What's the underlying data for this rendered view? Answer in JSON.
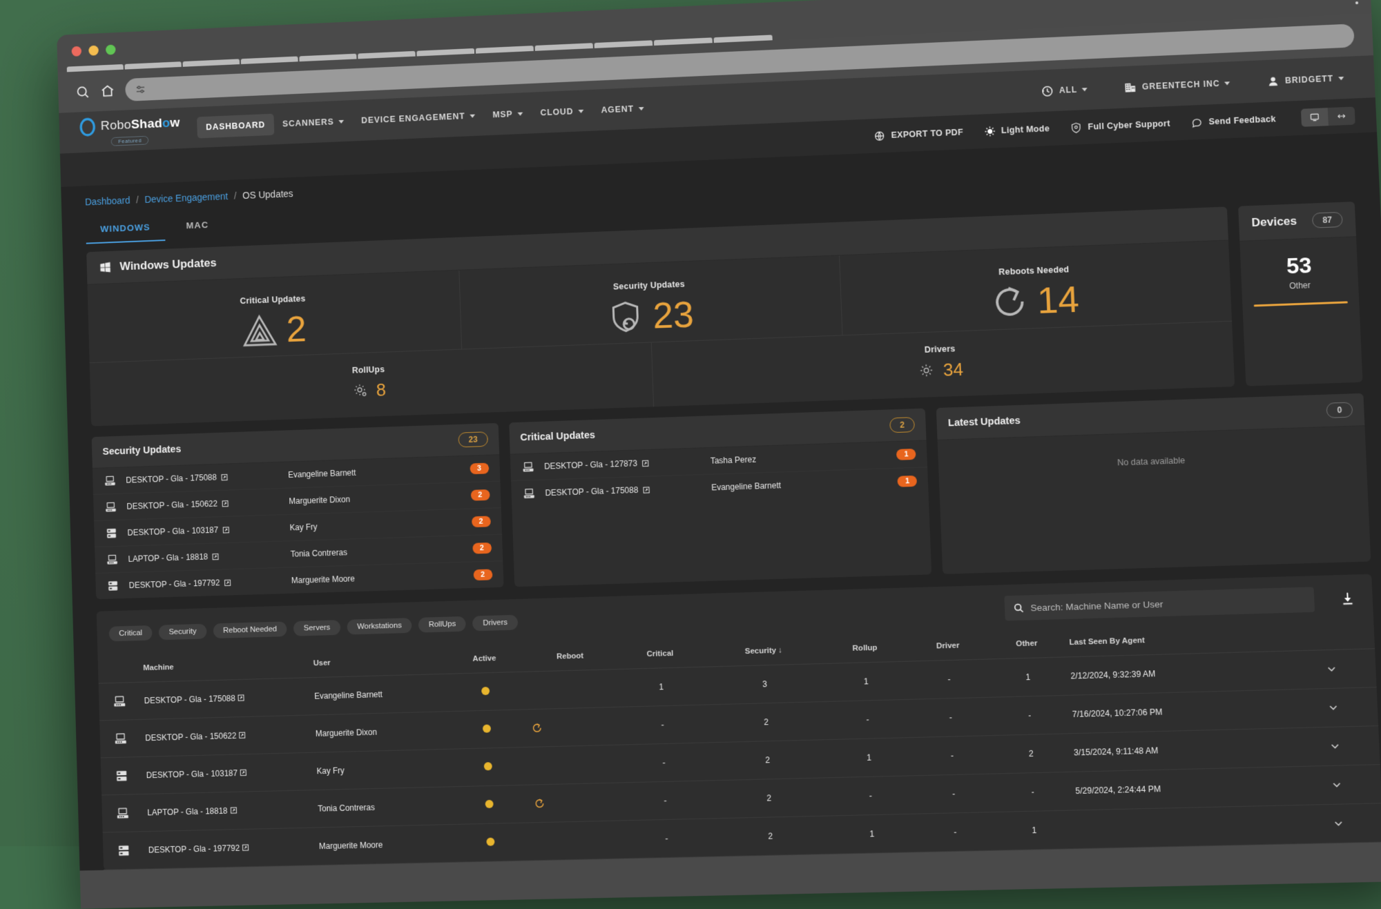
{
  "browser": {
    "search_icon": "search-icon",
    "home_icon": "home-icon",
    "omnibox_icon": "tune-icon",
    "menu_icon": "kebab-menu-icon"
  },
  "nav": {
    "brand_pre": "Robo",
    "brand_bold": "Shad",
    "brand_o": "o",
    "brand_post": "w",
    "brand_badge": "Featured",
    "items": [
      {
        "label": "DASHBOARD",
        "caret": false,
        "active": true
      },
      {
        "label": "SCANNERS",
        "caret": true,
        "active": false
      },
      {
        "label": "DEVICE ENGAGEMENT",
        "caret": true,
        "active": false
      },
      {
        "label": "MSP",
        "caret": true,
        "active": false
      },
      {
        "label": "CLOUD",
        "caret": true,
        "active": false
      },
      {
        "label": "AGENT",
        "caret": true,
        "active": false
      }
    ],
    "right": [
      {
        "label": "ALL",
        "icon": "history-icon",
        "caret": true
      },
      {
        "label": "GREENTECH INC",
        "icon": "building-icon",
        "caret": true
      },
      {
        "label": "BRIDGETT",
        "icon": "person-icon",
        "caret": true
      }
    ]
  },
  "subbar": {
    "export_label": "EXPORT TO PDF",
    "light_mode_label": "Light Mode",
    "support_label": "Full Cyber Support",
    "feedback_label": "Send Feedback",
    "seg_left_icon": "monitor-icon",
    "seg_right_icon": "expand-horizontal-icon"
  },
  "breadcrumb": {
    "item1": "Dashboard",
    "sep": "/",
    "item2": "Device Engagement",
    "current": "OS Updates"
  },
  "tabs": [
    {
      "label": "WINDOWS",
      "selected": true
    },
    {
      "label": "MAC",
      "selected": false
    }
  ],
  "windows_updates": {
    "title": "Windows Updates",
    "icon": "windows-icon",
    "stats_top": [
      {
        "label": "Critical Updates",
        "value": "2",
        "icon": "warning-triangle-icon"
      },
      {
        "label": "Security Updates",
        "value": "23",
        "icon": "shield-refresh-icon"
      },
      {
        "label": "Reboots Needed",
        "value": "14",
        "icon": "reboot-icon"
      }
    ],
    "stats_bottom": [
      {
        "label": "RollUps",
        "value": "8",
        "icon": "gear-icon"
      },
      {
        "label": "Drivers",
        "value": "34",
        "icon": "gear-icon"
      }
    ]
  },
  "devices": {
    "title": "Devices",
    "count": "87",
    "value": "53",
    "label": "Other",
    "bar_color": "#e8a33d"
  },
  "panels": [
    {
      "title": "Security Updates",
      "count": "23",
      "rows": [
        {
          "icon": "desktop-icon",
          "machine": "DESKTOP - Gla - 175088",
          "link_icon": "external-link-icon",
          "user": "Evangeline Barnett",
          "badge": "3"
        },
        {
          "icon": "desktop-icon",
          "machine": "DESKTOP - Gla - 150622",
          "link_icon": "external-link-icon",
          "user": "Marguerite Dixon",
          "badge": "2"
        },
        {
          "icon": "server-icon",
          "machine": "DESKTOP - Gla - 103187",
          "link_icon": "external-link-icon",
          "user": "Kay Fry",
          "badge": "2"
        },
        {
          "icon": "desktop-icon",
          "machine": "LAPTOP - Gla - 18818",
          "link_icon": "external-link-icon",
          "user": "Tonia Contreras",
          "badge": "2"
        },
        {
          "icon": "server-icon",
          "machine": "DESKTOP - Gla - 197792",
          "link_icon": "external-link-icon",
          "user": "Marguerite Moore",
          "badge": "2"
        }
      ],
      "empty": ""
    },
    {
      "title": "Critical Updates",
      "count": "2",
      "rows": [
        {
          "icon": "desktop-icon",
          "machine": "DESKTOP - Gla - 127873",
          "link_icon": "external-link-icon",
          "user": "Tasha Perez",
          "badge": "1"
        },
        {
          "icon": "desktop-icon",
          "machine": "DESKTOP - Gla - 175088",
          "link_icon": "external-link-icon",
          "user": "Evangeline Barnett",
          "badge": "1"
        }
      ],
      "empty": ""
    },
    {
      "title": "Latest Updates",
      "count": "0",
      "rows": [],
      "empty": "No data available"
    }
  ],
  "filters": {
    "chips": [
      "Critical",
      "Security",
      "Reboot Needed",
      "Servers",
      "Workstations",
      "RollUps",
      "Drivers"
    ],
    "search_placeholder": "Search: Machine Name or User",
    "search_value": "",
    "search_icon": "search-icon",
    "download_icon": "download-icon"
  },
  "table": {
    "columns": [
      "",
      "Machine",
      "User",
      "Active",
      "Reboot",
      "Critical",
      "Security ↓",
      "Rollup",
      "Driver",
      "Other",
      "Last Seen By Agent",
      ""
    ],
    "rows": [
      {
        "icon": "desktop-icon",
        "machine": "DESKTOP - Gla - 175088",
        "link_icon": "external-link-icon",
        "user": "Evangeline Barnett",
        "active": "active-dot",
        "reboot": "",
        "critical": "1",
        "security": "3",
        "rollup": "1",
        "driver": "-",
        "other": "1",
        "last_seen": "2/12/2024, 9:32:39 AM",
        "expand_icon": "chevron-down-icon"
      },
      {
        "icon": "desktop-icon",
        "machine": "DESKTOP - Gla - 150622",
        "link_icon": "external-link-icon",
        "user": "Marguerite Dixon",
        "active": "active-dot",
        "reboot": "reboot-icon",
        "critical": "-",
        "security": "2",
        "rollup": "-",
        "driver": "-",
        "other": "-",
        "last_seen": "7/16/2024, 10:27:06 PM",
        "expand_icon": "chevron-down-icon"
      },
      {
        "icon": "server-icon",
        "machine": "DESKTOP - Gla - 103187",
        "link_icon": "external-link-icon",
        "user": "Kay Fry",
        "active": "active-dot",
        "reboot": "",
        "critical": "-",
        "security": "2",
        "rollup": "1",
        "driver": "-",
        "other": "2",
        "last_seen": "3/15/2024, 9:11:48 AM",
        "expand_icon": "chevron-down-icon"
      },
      {
        "icon": "desktop-icon",
        "machine": "LAPTOP - Gla - 18818",
        "link_icon": "external-link-icon",
        "user": "Tonia Contreras",
        "active": "active-dot",
        "reboot": "reboot-icon",
        "critical": "-",
        "security": "2",
        "rollup": "-",
        "driver": "-",
        "other": "-",
        "last_seen": "5/29/2024, 2:24:44 PM",
        "expand_icon": "chevron-down-icon"
      },
      {
        "icon": "server-icon",
        "machine": "DESKTOP - Gla - 197792",
        "link_icon": "external-link-icon",
        "user": "Marguerite Moore",
        "active": "active-dot",
        "reboot": "",
        "critical": "-",
        "security": "2",
        "rollup": "1",
        "driver": "-",
        "other": "1",
        "last_seen": "",
        "expand_icon": "chevron-down-icon"
      }
    ]
  }
}
